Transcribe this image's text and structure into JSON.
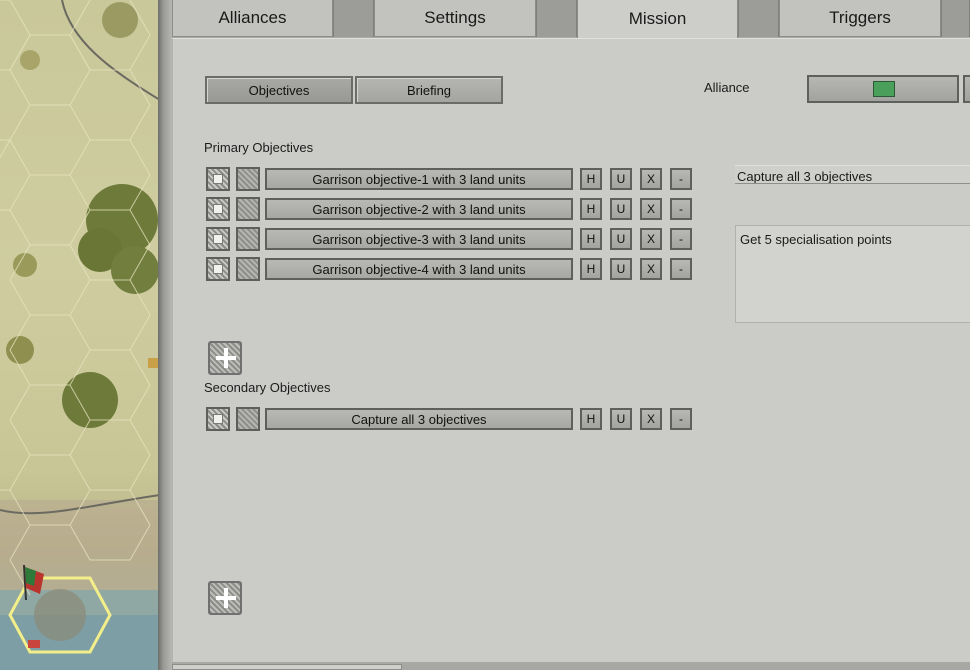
{
  "tabs": [
    {
      "label": "Alliances"
    },
    {
      "label": "Settings"
    },
    {
      "label": "Mission",
      "active": true
    },
    {
      "label": "Triggers"
    }
  ],
  "subtabs": {
    "objectives": "Objectives",
    "briefing": "Briefing"
  },
  "alliance": {
    "label": "Alliance",
    "color": "#4aa05a"
  },
  "primary": {
    "heading": "Primary Objectives",
    "items": [
      {
        "label": "Garrison objective-1 with 3 land units"
      },
      {
        "label": "Garrison objective-2 with 3 land units"
      },
      {
        "label": "Garrison objective-3 with 3 land units"
      },
      {
        "label": "Garrison objective-4 with 3 land units"
      }
    ]
  },
  "secondary": {
    "heading": "Secondary Objectives",
    "items": [
      {
        "label": "Capture all 3 objectives"
      }
    ]
  },
  "row_buttons": {
    "h": "H",
    "u": "U",
    "x": "X",
    "remove": "-"
  },
  "details": {
    "title": "Capture all 3 objectives",
    "description": "Get 5 specialisation points"
  }
}
